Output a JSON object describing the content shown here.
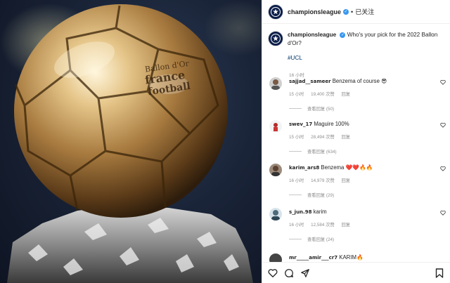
{
  "post": {
    "username": "championsleague",
    "follow_status": "已关注",
    "caption": "Who's your pick for the 2022 Ballon d'Or?",
    "hashtag": "#UCL",
    "time": "16 小时",
    "ball_text_1": "Ballon d'Or",
    "ball_text_2": "france",
    "ball_text_3": "football"
  },
  "comments": [
    {
      "username": "sajjad__sameer",
      "text": "Benzema of course 😎",
      "time": "15 小时",
      "likes": "19,400 次赞",
      "reply": "回复",
      "view_replies": "查看回复 (50)"
    },
    {
      "username": "swev_17",
      "text": "Maguire 100%",
      "time": "15 小时",
      "likes": "28,494 次赞",
      "reply": "回复",
      "view_replies": "查看回复 (634)"
    },
    {
      "username": "karim_ars8",
      "text": "Benzema ❤️❤️🔥🔥",
      "time": "16 小时",
      "likes": "14,979 次赞",
      "reply": "回复",
      "view_replies": "查看回复 (29)"
    },
    {
      "username": "s_jun.98",
      "text": "karim",
      "time": "16 小时",
      "likes": "12,584 次赞",
      "reply": "回复",
      "view_replies": "查看回复 (24)"
    },
    {
      "username": "mr_____amir___cr7",
      "text": "KARIM🔥"
    }
  ],
  "icons": {
    "like": "heart-icon",
    "comment": "comment-icon",
    "share": "paper-plane-icon",
    "save": "bookmark-icon"
  },
  "colors": {
    "hashtag": "#00376b",
    "verified": "#3897f0",
    "muted": "#8e8e8e"
  }
}
